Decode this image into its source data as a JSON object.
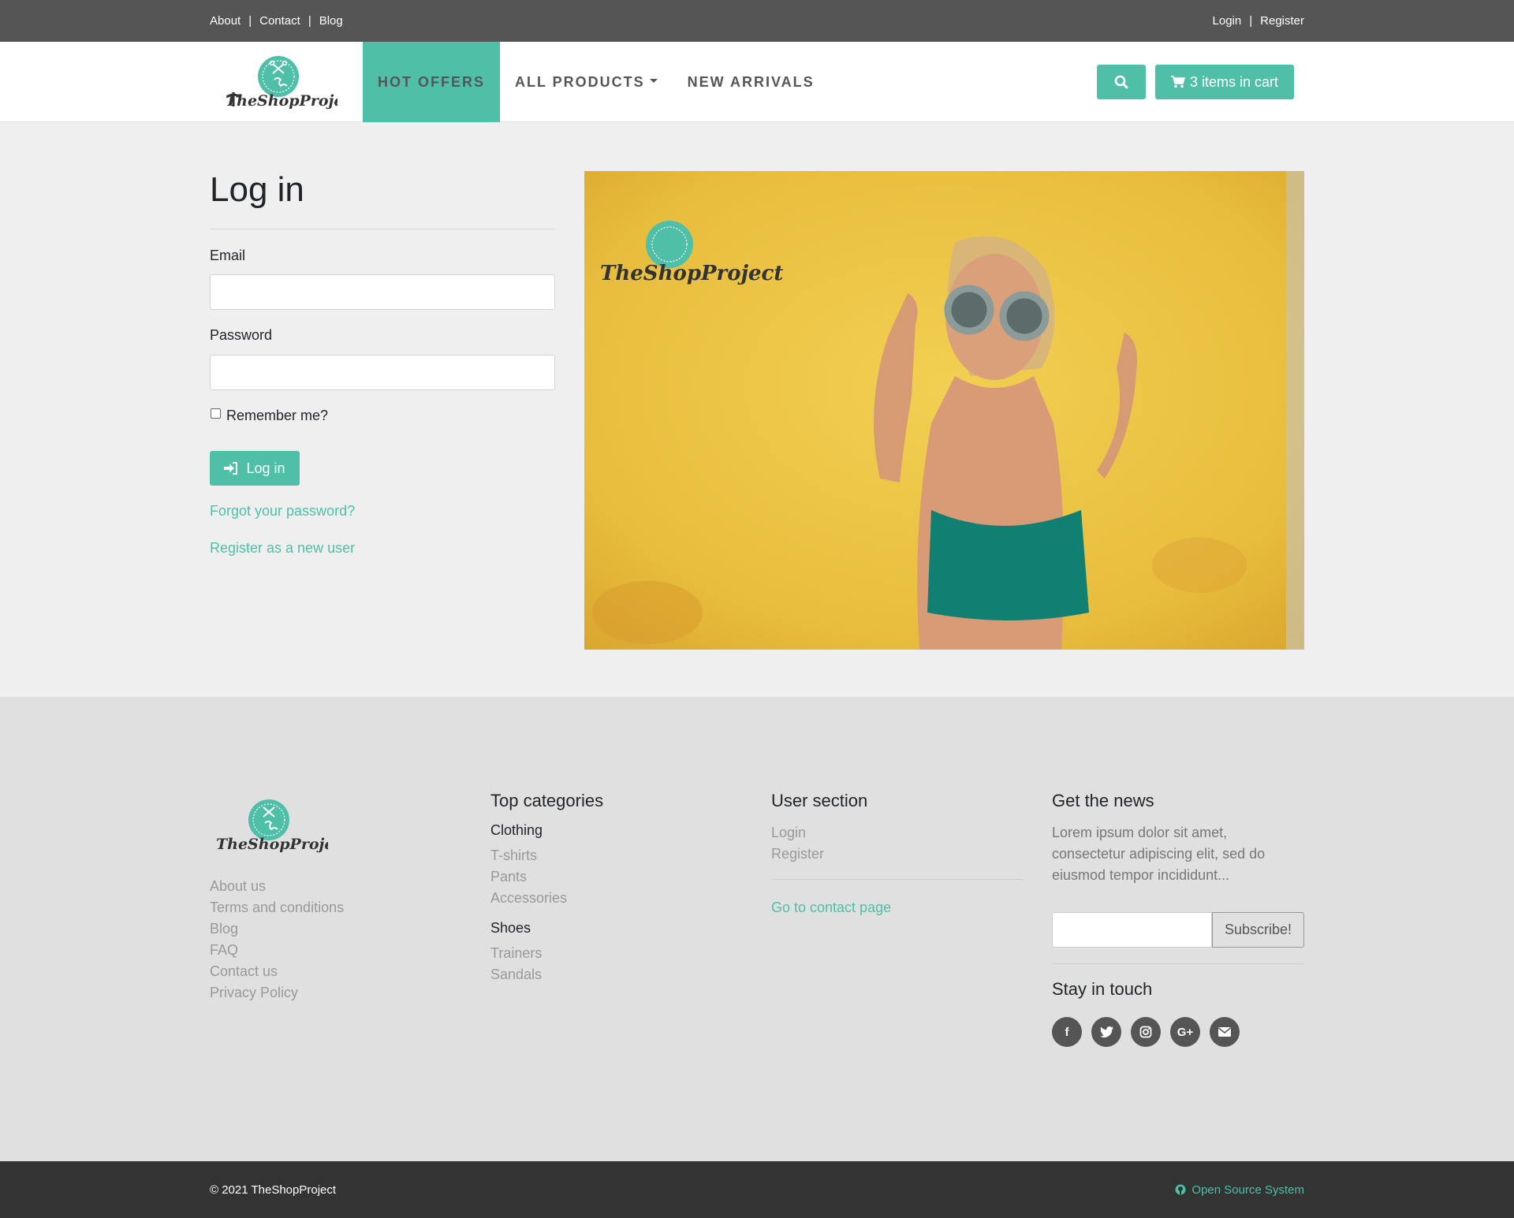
{
  "topbar": {
    "left_links": [
      "About",
      "Contact",
      "Blog"
    ],
    "right_links": [
      "Login",
      "Register"
    ]
  },
  "brand": {
    "name": "TheShopProject",
    "accent": "#4fbfa8"
  },
  "nav": {
    "items": [
      {
        "label": "HOT OFFERS"
      },
      {
        "label": "ALL PRODUCTS"
      },
      {
        "label": "NEW ARRIVALS"
      }
    ],
    "search_icon": "search-icon",
    "cart_label": "3 items in cart"
  },
  "login": {
    "title": "Log in",
    "email_label": "Email",
    "password_label": "Password",
    "remember_label": "Remember me?",
    "submit_label": "Log in",
    "forgot_link": "Forgot your password?",
    "register_link": "Register as a new user"
  },
  "footer": {
    "about_links": [
      "About us",
      "Terms and conditions",
      "Blog",
      "FAQ",
      "Contact us",
      "Privacy Policy"
    ],
    "categories": {
      "heading": "Top categories",
      "groups": [
        {
          "name": "Clothing",
          "items": [
            "T-shirts",
            "Pants",
            "Accessories"
          ]
        },
        {
          "name": "Shoes",
          "items": [
            "Trainers",
            "Sandals"
          ]
        }
      ]
    },
    "user_section": {
      "heading": "User section",
      "links": [
        "Login",
        "Register"
      ],
      "contact_link": "Go to contact page"
    },
    "news": {
      "heading": "Get the news",
      "text": "Lorem ipsum dolor sit amet, consectetur adipiscing elit, sed do eiusmod tempor incididunt...",
      "subscribe_label": "Subscribe!"
    },
    "stay_in_touch": {
      "heading": "Stay in touch",
      "icons": [
        "facebook-icon",
        "twitter-icon",
        "instagram-icon",
        "google-plus-icon",
        "envelope-icon"
      ]
    }
  },
  "bottombar": {
    "copyright": "© 2021 TheShopProject",
    "oss_label": "Open Source System"
  }
}
